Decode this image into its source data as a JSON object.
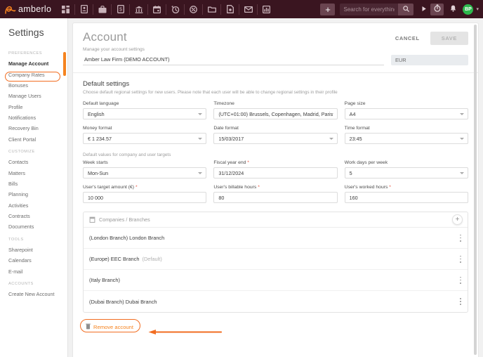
{
  "topbar": {
    "brand": "amberlo",
    "nav_icons": [
      {
        "name": "dashboard-icon",
        "label": "Dashboard"
      },
      {
        "name": "contacts-icon",
        "label": "Contacts"
      },
      {
        "name": "matters-icon",
        "label": "Matters"
      },
      {
        "name": "bills-icon",
        "label": "Bills"
      },
      {
        "name": "bank-icon",
        "label": "Accounting"
      },
      {
        "name": "calendar-icon",
        "label": "Calendar"
      },
      {
        "name": "time-icon",
        "label": "Time tracking"
      },
      {
        "name": "tasks-icon",
        "label": "Tasks"
      },
      {
        "name": "folder-icon",
        "label": "Documents"
      },
      {
        "name": "contracts-icon",
        "label": "Contracts"
      },
      {
        "name": "mail-icon",
        "label": "E-mail"
      },
      {
        "name": "reports-icon",
        "label": "Reports"
      }
    ],
    "add_label": "+",
    "search": {
      "placeholder": "Search for everything...",
      "value": ""
    },
    "avatar_initials": "BP",
    "caret": "▾"
  },
  "sidebar": {
    "title": "Settings",
    "scroll_color": "#f5831f",
    "groups": [
      {
        "section": "PREFERENCES",
        "items": [
          {
            "label": "Manage Account",
            "active": true
          },
          {
            "label": "Company Rates",
            "active": false
          },
          {
            "label": "Bonuses",
            "active": false
          },
          {
            "label": "Manage Users",
            "active": false
          },
          {
            "label": "Profile",
            "active": false
          },
          {
            "label": "Notifications",
            "active": false
          },
          {
            "label": "Recovery Bin",
            "active": false
          },
          {
            "label": "Client Portal",
            "active": false
          }
        ]
      },
      {
        "section": "CUSTOMIZE",
        "items": [
          {
            "label": "Contacts",
            "active": false
          },
          {
            "label": "Matters",
            "active": false
          },
          {
            "label": "Bills",
            "active": false
          },
          {
            "label": "Planning",
            "active": false
          },
          {
            "label": "Activities",
            "active": false
          },
          {
            "label": "Contracts",
            "active": false
          },
          {
            "label": "Documents",
            "active": false
          }
        ]
      },
      {
        "section": "TOOLS",
        "items": [
          {
            "label": "Sharepoint",
            "active": false
          },
          {
            "label": "Calendars",
            "active": false
          },
          {
            "label": "E-mail",
            "active": false
          }
        ]
      },
      {
        "section": "ACCOUNTS",
        "items": [
          {
            "label": "Create New Account",
            "active": false
          }
        ]
      }
    ]
  },
  "page": {
    "title": "Account",
    "subtitle": "Manage your account settings",
    "cancel_label": "CANCEL",
    "save_label": "SAVE",
    "account_name": "Amber Law Firm (DEMO ACCOUNT)",
    "currency": "EUR"
  },
  "default_settings": {
    "title": "Default settings",
    "subtitle": "Choose default regional settings for new users. Please note that each user will be able to change regional settings in their profile",
    "fields_row1": [
      {
        "label": "Default language",
        "value": "English",
        "type": "select",
        "required": false
      },
      {
        "label": "Timezone",
        "value": "(UTC+01:00) Brussels, Copenhagen, Madrid, Paris",
        "type": "select",
        "required": false
      },
      {
        "label": "Page size",
        "value": "A4",
        "type": "select",
        "required": false
      }
    ],
    "fields_row2": [
      {
        "label": "Money format",
        "value": "€ 1 234.57",
        "type": "select",
        "required": false
      },
      {
        "label": "Date format",
        "value": "15/03/2017",
        "type": "select",
        "required": false
      },
      {
        "label": "Time format",
        "value": "23:45",
        "type": "select",
        "required": false
      }
    ]
  },
  "targets": {
    "subtitle": "Default values for company and user targets",
    "fields_row1": [
      {
        "label": "Week starts",
        "value": "Mon-Sun",
        "type": "select",
        "required": false
      },
      {
        "label": "Fiscal year end",
        "value": "31/12/2024",
        "type": "input",
        "required": true
      },
      {
        "label": "Work days per week",
        "value": "5",
        "type": "select",
        "required": false
      }
    ],
    "fields_row2": [
      {
        "label": "User's target amount (€)",
        "value": "10 000",
        "type": "input",
        "required": true
      },
      {
        "label": "User's billable hours",
        "value": "80",
        "type": "input",
        "required": true
      },
      {
        "label": "User's worked hours",
        "value": "160",
        "type": "input",
        "required": true
      }
    ]
  },
  "branches": {
    "header_label": "Companies / Branches",
    "add_label": "+",
    "rows": [
      {
        "name": "(London Branch) London Branch",
        "tag": ""
      },
      {
        "name": "(Europe) EEC Branch",
        "tag": "(Default)"
      },
      {
        "name": "(Italy Branch)",
        "tag": ""
      },
      {
        "name": "(Dubai Branch) Dubai Branch",
        "tag": ""
      }
    ]
  },
  "remove": {
    "label": "Remove account",
    "color": "#f5831f"
  },
  "annotation": {
    "color": "#f26d21"
  }
}
